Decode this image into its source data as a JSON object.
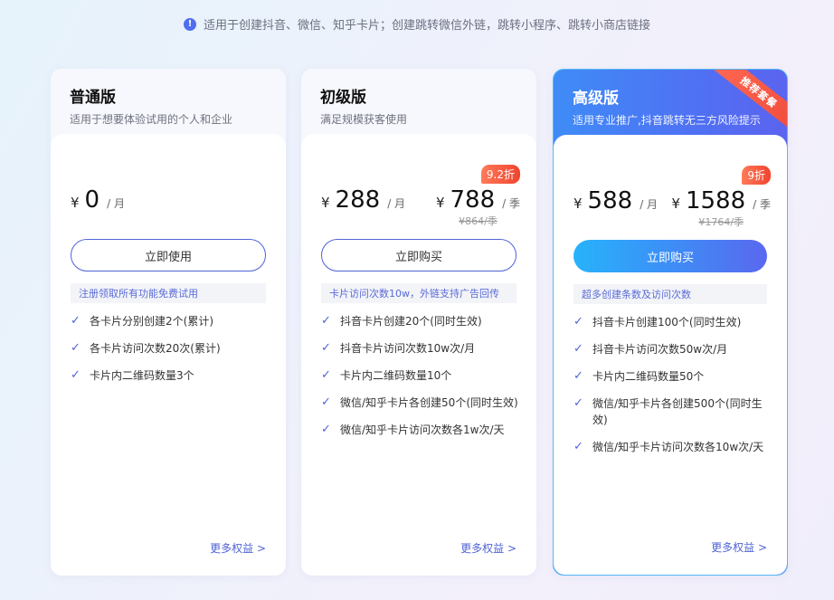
{
  "notice": {
    "icon": "info-icon",
    "text": "适用于创建抖音、微信、知乎卡片；创建跳转微信外链，跳转小程序、跳转小商店链接"
  },
  "colors": {
    "accent": "#4f63d6",
    "badge": "#f04a3a",
    "pro_gradient_start": "#27b3fb",
    "pro_gradient_end": "#5a68ef"
  },
  "plans": [
    {
      "title": "普通版",
      "subtitle": "适用于想要体验试用的个人和企业",
      "currency": "¥",
      "price": "0",
      "per": "/ 月",
      "cta": "立即使用",
      "tip": "注册领取所有功能免费试用",
      "features": [
        "各卡片分别创建2个(累计)",
        "各卡片访问次数20次(累计)",
        "卡片内二维码数量3个"
      ],
      "more": "更多权益 >"
    },
    {
      "title": "初级版",
      "subtitle": "满足规模获客使用",
      "currency": "¥",
      "price": "288",
      "per": "/ 月",
      "price2": "788",
      "per2": "/ 季",
      "orig": "¥864/季",
      "badge": "9.2折",
      "cta": "立即购买",
      "tip": "卡片访问次数10w，外链支持广告回传",
      "features": [
        "抖音卡片创建20个(同时生效)",
        "抖音卡片访问次数10w次/月",
        "卡片内二维码数量10个",
        "微信/知乎卡片各创建50个(同时生效)",
        "微信/知乎卡片访问次数各1w次/天"
      ],
      "more": "更多权益 >"
    },
    {
      "title": "高级版",
      "subtitle": "适用专业推广,抖音跳转无三方风险提示",
      "ribbon": "推荐套餐",
      "currency": "¥",
      "price": "588",
      "per": "/ 月",
      "price2": "1588",
      "per2": "/ 季",
      "orig": "¥1764/季",
      "badge": "9折",
      "cta": "立即购买",
      "tip": "超多创建条数及访问次数",
      "features": [
        "抖音卡片创建100个(同时生效)",
        "抖音卡片访问次数50w次/月",
        "卡片内二维码数量50个",
        "微信/知乎卡片各创建500个(同时生效)",
        "微信/知乎卡片访问次数各10w次/天"
      ],
      "more": "更多权益 >"
    }
  ]
}
